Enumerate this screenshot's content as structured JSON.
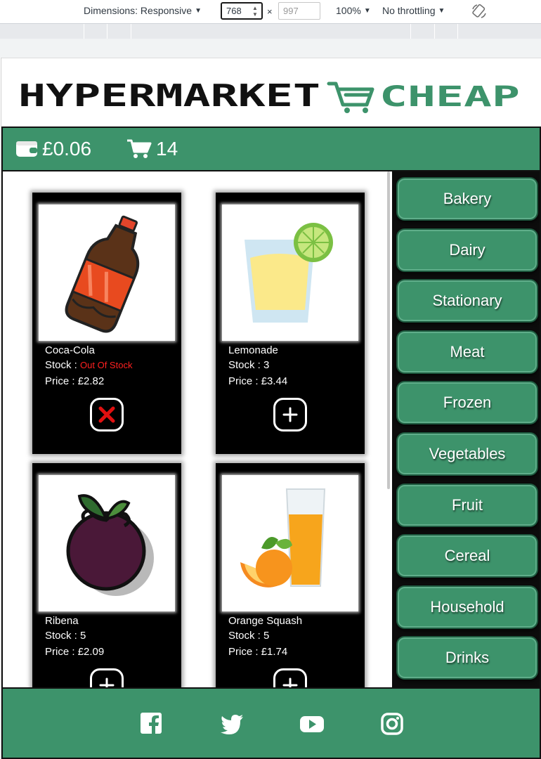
{
  "devtools": {
    "dimensions_label": "Dimensions: Responsive",
    "width_value": "768",
    "times": "×",
    "height_placeholder": "997",
    "zoom": "100%",
    "throttling": "No throttling"
  },
  "site": {
    "logo_left": "HYPERMARKET",
    "logo_right": "CHEAP",
    "brand_color": "#3d936b",
    "wallet_balance": "£0.06",
    "cart_count": "14"
  },
  "labels": {
    "stock": "Stock :",
    "price": "Price :"
  },
  "products": [
    {
      "name": "Coca-Cola",
      "stock": "Out Of Stock",
      "price": "£2.82",
      "image_icon": "cola-bottle-icon",
      "action": "out-of-stock-icon"
    },
    {
      "name": "Lemonade",
      "stock": "3",
      "price": "£3.44",
      "image_icon": "lemonade-glass-icon",
      "action": "add-icon"
    },
    {
      "name": "Ribena",
      "stock": "5",
      "price": "£2.09",
      "image_icon": "blackcurrant-icon",
      "action": "add-icon"
    },
    {
      "name": "Orange Squash",
      "stock": "5",
      "price": "£1.74",
      "image_icon": "orange-juice-icon",
      "action": "add-icon"
    }
  ],
  "categories": [
    "Bakery",
    "Dairy",
    "Stationary",
    "Meat",
    "Frozen",
    "Vegetables",
    "Fruit",
    "Cereal",
    "Household",
    "Drinks"
  ],
  "footer": {
    "social": [
      "facebook-icon",
      "twitter-icon",
      "youtube-icon",
      "instagram-icon"
    ]
  }
}
